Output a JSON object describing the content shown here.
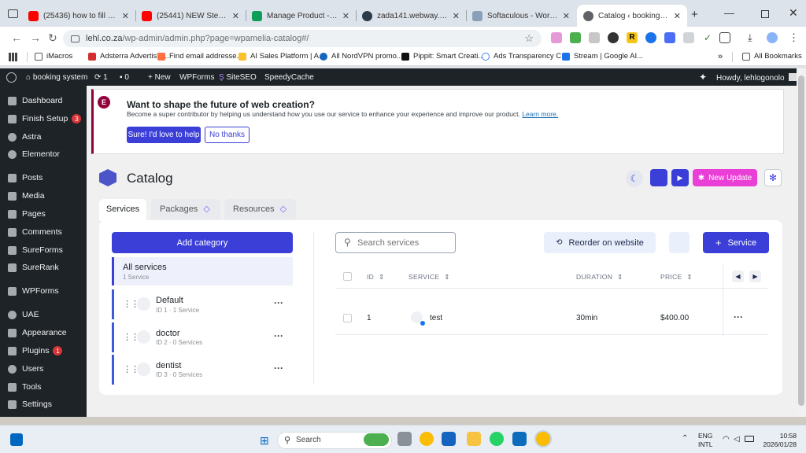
{
  "browser": {
    "tabs": [
      {
        "title": "(25436) how to fill up ame",
        "color": "#ff0000"
      },
      {
        "title": "(25441) NEW Step-by-step",
        "color": "#ff0000"
      },
      {
        "title": "Manage Product - Webwa",
        "color": "#0f9d58"
      },
      {
        "title": "zada141.webway.host | Da",
        "color": "#2d3a4a"
      },
      {
        "title": "Softaculous - WordPress M",
        "color": "#8aa0b8"
      },
      {
        "title": "Catalog ‹ booking system",
        "color": "#5f6368"
      }
    ],
    "new_tab": "+",
    "url_host": "lehl.co.za",
    "url_path": "/wp-admin/admin.php?page=wpamelia-catalog#/",
    "bookmarks": [
      "iMacros",
      "Adsterra Advertisin...",
      "Find email addresse...",
      "AI Sales Platform | A...",
      "All NordVPN promo...",
      "Pippit: Smart Creati...",
      "Ads Transparency C...",
      "Stream | Google AI..."
    ],
    "bookmarks_more": "»",
    "all_bookmarks": "All Bookmarks"
  },
  "adminbar": {
    "site_name": "booking system",
    "updates_count": "1",
    "comments_count": "0",
    "new_label": "New",
    "items": [
      "WPForms",
      "SiteSEO",
      "SpeedyCache"
    ],
    "greeting": "Howdy, lehlogonolo"
  },
  "sidebar": {
    "items": [
      {
        "label": "Dashboard",
        "badge": ""
      },
      {
        "label": "Finish Setup",
        "badge": "3"
      },
      {
        "label": "Astra",
        "badge": ""
      },
      {
        "label": "Elementor",
        "badge": ""
      },
      {
        "label": "Posts",
        "badge": ""
      },
      {
        "label": "Media",
        "badge": ""
      },
      {
        "label": "Pages",
        "badge": ""
      },
      {
        "label": "Comments",
        "badge": ""
      },
      {
        "label": "SureForms",
        "badge": ""
      },
      {
        "label": "SureRank",
        "badge": ""
      },
      {
        "label": "WPForms",
        "badge": ""
      },
      {
        "label": "UAE",
        "badge": ""
      },
      {
        "label": "Appearance",
        "badge": ""
      },
      {
        "label": "Plugins",
        "badge": "1"
      },
      {
        "label": "Users",
        "badge": ""
      },
      {
        "label": "Tools",
        "badge": ""
      },
      {
        "label": "Settings",
        "badge": ""
      }
    ]
  },
  "notice": {
    "title": "Want to shape the future of web creation?",
    "text": "Become a super contributor by helping us understand how you use our service to enhance your experience and improve our product.",
    "link": "Learn more.",
    "accept": "Sure! I'd love to help",
    "decline": "No thanks"
  },
  "catalog": {
    "title": "Catalog",
    "new_update": "New Update",
    "tabs": [
      "Services",
      "Packages",
      "Resources"
    ],
    "add_category": "Add category",
    "all_services": "All services",
    "all_services_count": "1 Service",
    "categories": [
      {
        "name": "Default",
        "meta": "ID 1 · 1 Service"
      },
      {
        "name": "doctor",
        "meta": "ID 2 · 0 Services"
      },
      {
        "name": "dentist",
        "meta": "ID 3 · 0 Services"
      }
    ],
    "search_placeholder": "Search services",
    "reorder": "Reorder on website",
    "add_service": "Service",
    "columns": [
      "ID",
      "SERVICE",
      "DURATION",
      "PRICE"
    ],
    "rows": [
      {
        "id": "1",
        "service": "test",
        "duration": "30min",
        "price": "$400.00"
      }
    ]
  },
  "taskbar": {
    "search": "Search",
    "lang": "ENG",
    "lang2": "INTL",
    "time": "10:58",
    "date": "2026/01/28"
  },
  "colors": {
    "accent": "#3b3fd8",
    "pink": "#e93fd6",
    "wp_dark": "#1d2327"
  }
}
